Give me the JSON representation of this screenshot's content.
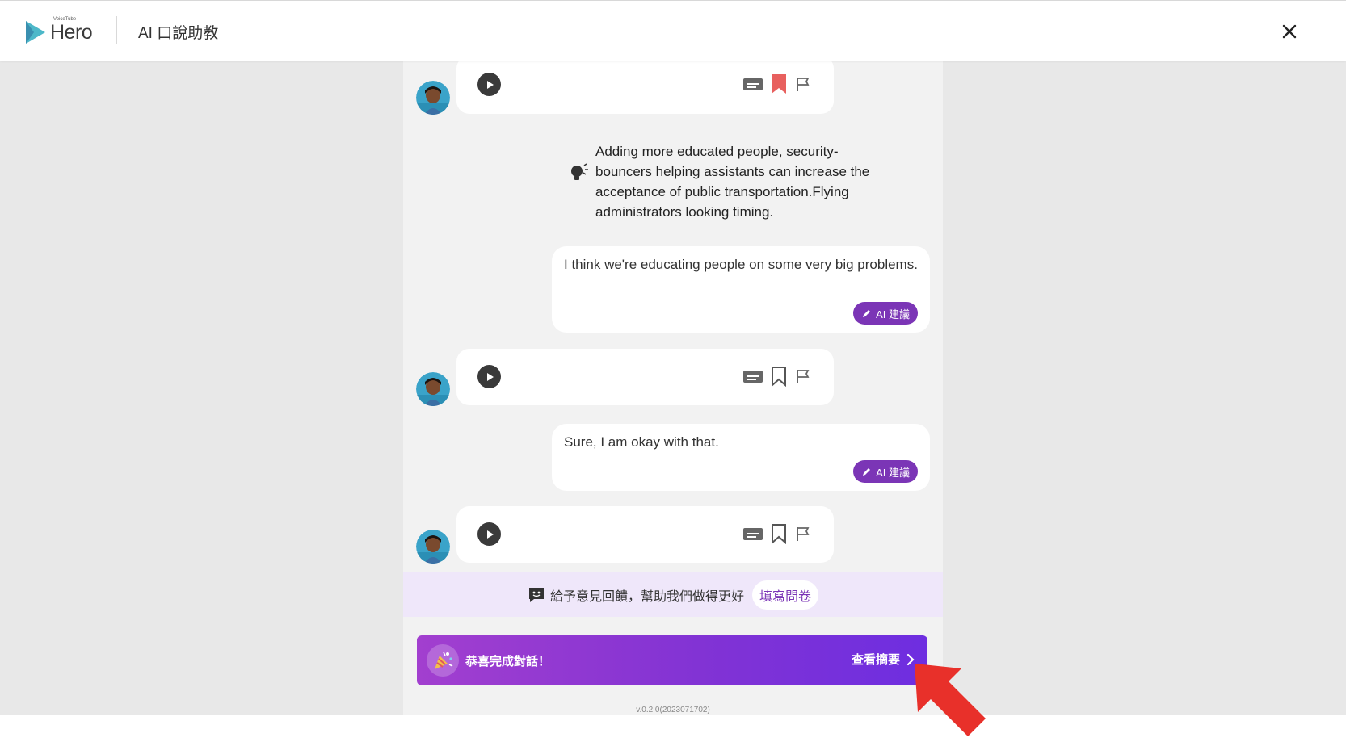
{
  "header": {
    "logo_small": "VoiceTube",
    "logo_name": "Hero",
    "title": "AI 口說助教"
  },
  "chat": {
    "hint": "Adding more educated people, security-bouncers helping assistants can increase the acceptance of public transportation.Flying administrators looking timing.",
    "user_messages": [
      "I think we're educating people on some very big problems.",
      "Sure, I am okay with that."
    ],
    "ai_button_label": "AI 建議"
  },
  "feedback": {
    "text": "給予意見回饋，幫助我們做得更好",
    "survey_label": "填寫問卷"
  },
  "finish": {
    "message": "恭喜完成對話！",
    "summary_label": "查看摘要"
  },
  "version": "v.0.2.0(2023071702)",
  "colors": {
    "accent": "#7b35b6",
    "bookmark_active": "#e8605e",
    "annotation_arrow": "#e8302a"
  },
  "icons": [
    "close-icon",
    "play-icon",
    "subtitle-icon",
    "bookmark-icon",
    "flag-icon",
    "lightbulb-icon",
    "pencil-icon",
    "feedback-icon",
    "party-icon",
    "chevron-right-icon"
  ]
}
